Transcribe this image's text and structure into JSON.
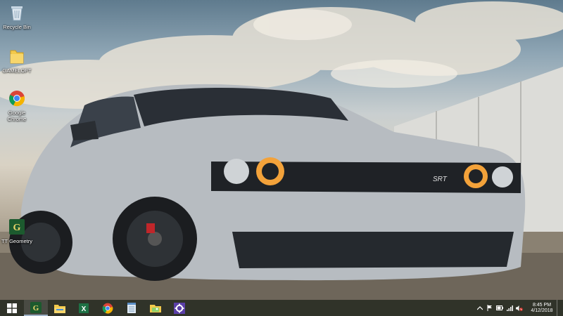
{
  "desktop": {
    "icons": [
      {
        "label": "Recycle Bin",
        "icon": "recycle-bin-icon"
      },
      {
        "label": "GAMELOFT",
        "icon": "folder-icon"
      },
      {
        "label": "Google Chrome",
        "icon": "chrome-icon"
      },
      {
        "label": "TT Geometry",
        "icon": "tt-geometry-icon"
      }
    ]
  },
  "taskbar": {
    "apps": [
      {
        "name": "start-button",
        "icon": "windows-logo-icon"
      },
      {
        "name": "tt-geometry",
        "icon": "tt-geometry-icon"
      },
      {
        "name": "file-explorer",
        "icon": "file-explorer-icon"
      },
      {
        "name": "excel",
        "icon": "excel-icon"
      },
      {
        "name": "chrome",
        "icon": "chrome-icon"
      },
      {
        "name": "notepad",
        "icon": "notepad-icon"
      },
      {
        "name": "photos",
        "icon": "photos-icon"
      },
      {
        "name": "settings-app",
        "icon": "gear-icon"
      }
    ],
    "clock": {
      "time": "8:45 PM",
      "date": "4/12/2018"
    }
  },
  "colors": {
    "taskbar": "#282a1e",
    "accent": "#9fb3c8",
    "car": "#b9bec3",
    "headlight": "#f3a23a"
  }
}
